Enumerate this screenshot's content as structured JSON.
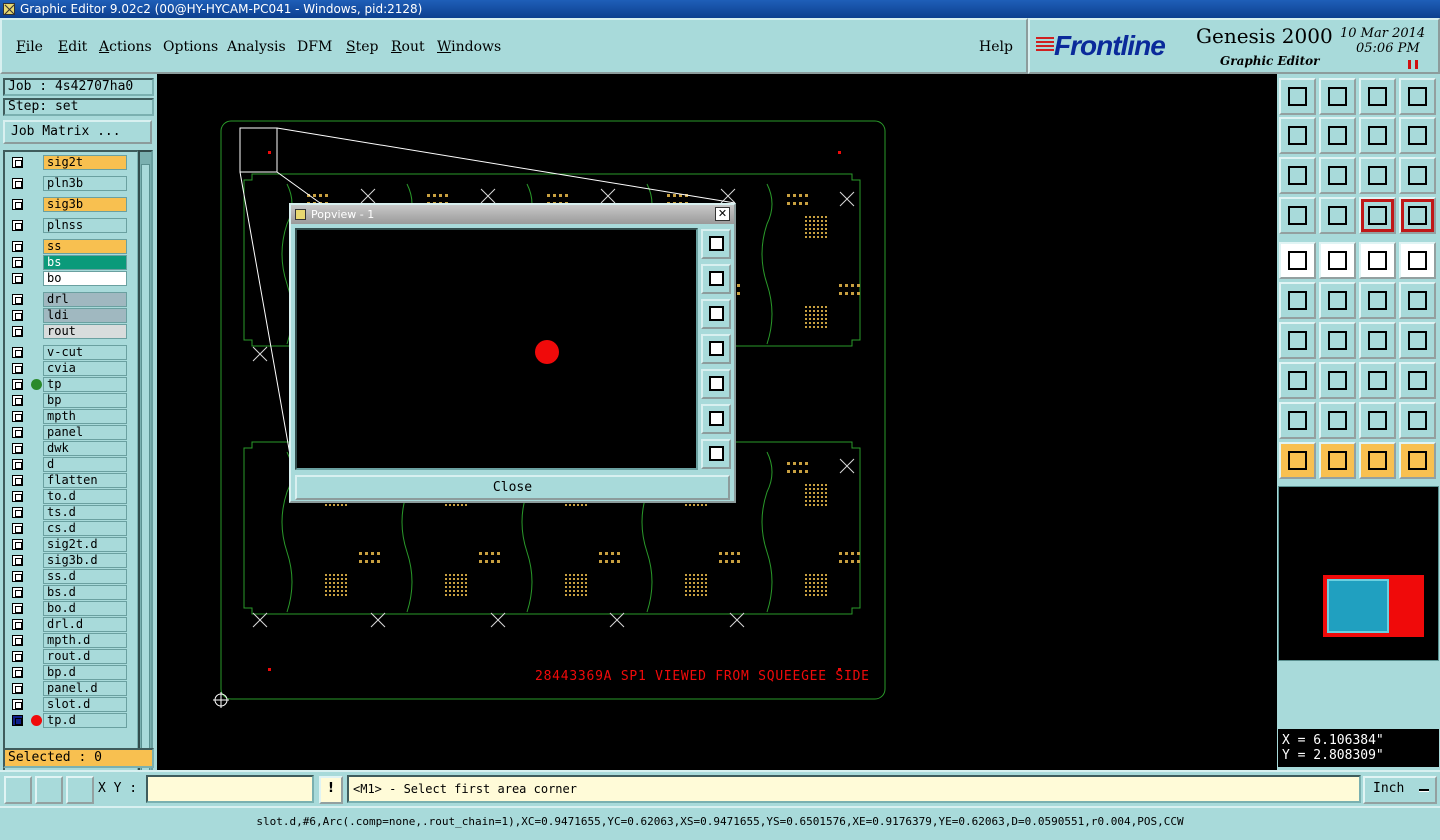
{
  "window": {
    "title": "Graphic Editor 9.02c2 (00@HY-HYCAM-PC041 - Windows, pid:2128)"
  },
  "menu": {
    "file": "File",
    "edit": "Edit",
    "actions": "Actions",
    "options": "Options",
    "analysis": "Analysis",
    "dfm": "DFM",
    "step": "Step",
    "rout": "Rout",
    "windows": "Windows",
    "help": "Help"
  },
  "banner": {
    "logo": "Frontline",
    "product": "Genesis 2000",
    "subtitle": "Graphic Editor",
    "date": "10 Mar 2014",
    "time": "05:06 PM"
  },
  "left": {
    "job": "Job : 4s42707ha0",
    "step": "Step: set",
    "job_matrix": "Job Matrix ...",
    "selected": "Selected : 0"
  },
  "layers": [
    {
      "name": "sig2t",
      "color": "orange"
    },
    {
      "name": "pln3b",
      "color": ""
    },
    {
      "name": "sig3b",
      "color": "orange"
    },
    {
      "name": "plnss",
      "color": ""
    },
    {
      "name": "ss",
      "color": "orange"
    },
    {
      "name": "bs",
      "color": "teal"
    },
    {
      "name": "bo",
      "color": "white"
    },
    {
      "name": "drl",
      "color": "gray"
    },
    {
      "name": "ldi",
      "color": "gray"
    },
    {
      "name": "rout",
      "color": "lightgray"
    },
    {
      "name": "v-cut",
      "color": ""
    },
    {
      "name": "cvia",
      "color": ""
    },
    {
      "name": "tp",
      "color": "",
      "dot": "#2a8a2a"
    },
    {
      "name": "bp",
      "color": ""
    },
    {
      "name": "mpth",
      "color": ""
    },
    {
      "name": "panel",
      "color": ""
    },
    {
      "name": "dwk",
      "color": ""
    },
    {
      "name": "d",
      "color": ""
    },
    {
      "name": "flatten",
      "color": ""
    },
    {
      "name": "to.d",
      "color": ""
    },
    {
      "name": "ts.d",
      "color": ""
    },
    {
      "name": "cs.d",
      "color": ""
    },
    {
      "name": "sig2t.d",
      "color": ""
    },
    {
      "name": "sig3b.d",
      "color": ""
    },
    {
      "name": "ss.d",
      "color": ""
    },
    {
      "name": "bs.d",
      "color": ""
    },
    {
      "name": "bo.d",
      "color": ""
    },
    {
      "name": "drl.d",
      "color": ""
    },
    {
      "name": "mpth.d",
      "color": ""
    },
    {
      "name": "rout.d",
      "color": ""
    },
    {
      "name": "bp.d",
      "color": ""
    },
    {
      "name": "panel.d",
      "color": ""
    },
    {
      "name": "slot.d",
      "color": ""
    },
    {
      "name": "tp.d",
      "color": "",
      "dot": "#f00a0a",
      "selected": true
    }
  ],
  "canvas": {
    "annotation": "28443369A SP1 VIEWED FROM SQUEEGEE SIDE",
    "colors": {
      "outline": "#2a9a2a",
      "pads": "#c8a040",
      "marker": "#f00a0a"
    }
  },
  "popview": {
    "title": "Popview - 1",
    "close_label": "Close"
  },
  "coords": {
    "x": "X = 6.106384\"",
    "y": "Y = 2.808309\""
  },
  "cmd": {
    "xy_label": "X Y :",
    "xy_value": "",
    "prompt": "<M1> - Select first area corner",
    "units": "Inch"
  },
  "status": "slot.d,#6,Arc(.comp=none,.rout_chain=1),XC=0.9471655,YC=0.62063,XS=0.9471655,YS=0.6501576,XE=0.9176379,YE=0.62063,D=0.0590551,r0.004,POS,CCW"
}
